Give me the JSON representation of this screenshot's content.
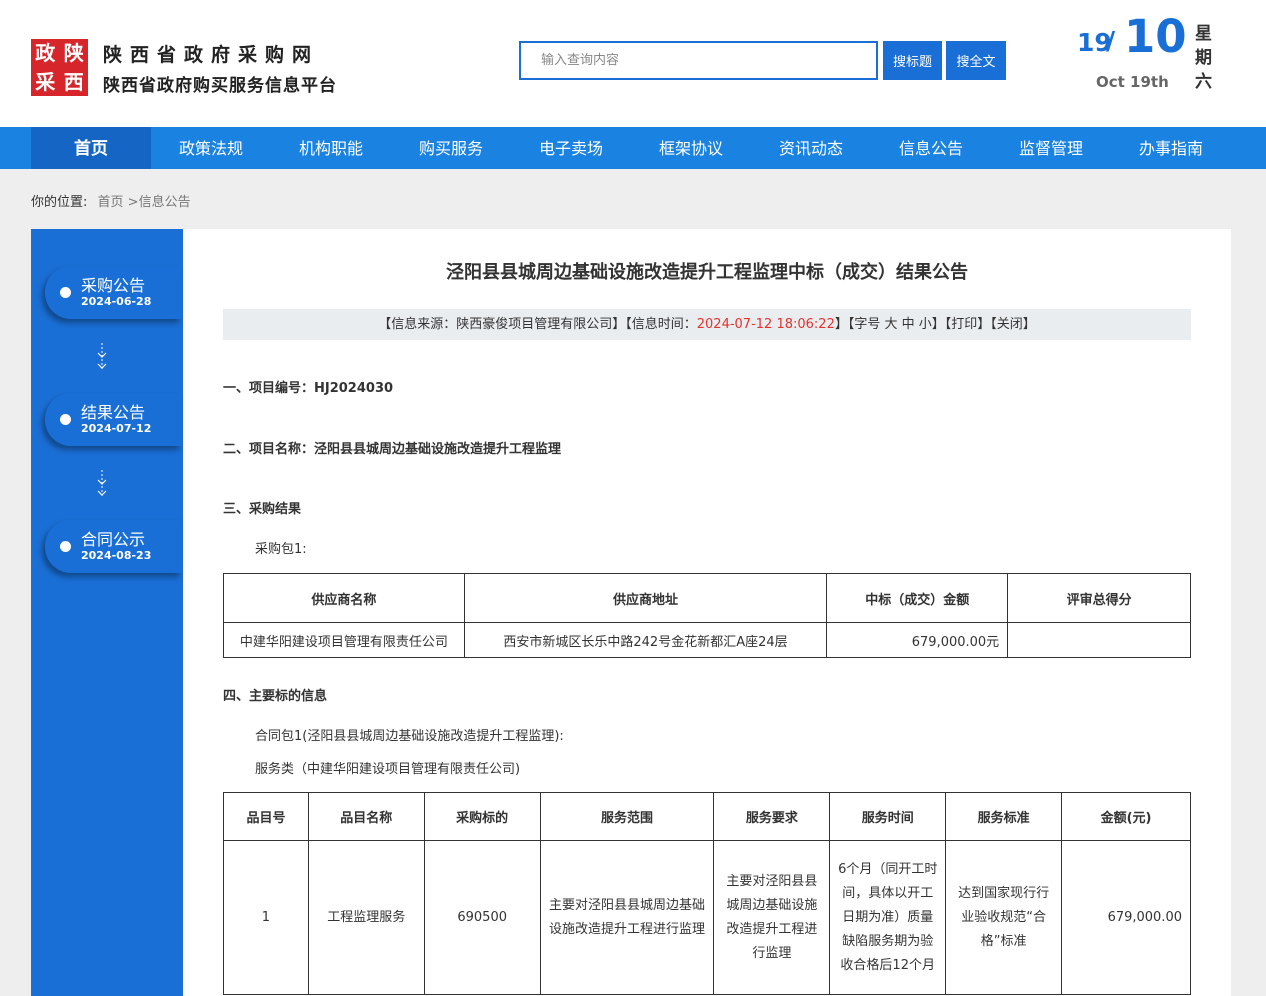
{
  "header": {
    "logo_chars": [
      "政",
      "陕",
      "采",
      "西"
    ],
    "site_title": "陕西省政府采购网",
    "site_subtitle": "陕西省政府购买服务信息平台",
    "search_placeholder": "输入查询内容",
    "btn_search_title": "搜标题",
    "btn_search_full": "搜全文",
    "date_day": "19",
    "date_slash": "/",
    "date_month": "10",
    "date_en": "Oct 19th",
    "date_week": "星期六"
  },
  "nav": {
    "items": [
      "首页",
      "政策法规",
      "机构职能",
      "购买服务",
      "电子卖场",
      "框架协议",
      "资讯动态",
      "信息公告",
      "监督管理",
      "办事指南"
    ]
  },
  "breadcrumb": {
    "prefix": "你的位置:",
    "home": "首页",
    "separator": " >",
    "current": "信息公告"
  },
  "sidebar": {
    "steps": [
      {
        "name": "采购公告",
        "date": "2024-06-28"
      },
      {
        "name": "结果公告",
        "date": "2024-07-12"
      },
      {
        "name": "合同公示",
        "date": "2024-08-23"
      }
    ]
  },
  "doc": {
    "title": "泾阳县县城周边基础设施改造提升工程监理中标（成交）结果公告",
    "info_source_prefix": "【信息来源：陕西豪俊项目管理有限公司】【信息时间：",
    "info_time": "2024-07-12 18:06:22",
    "info_suffix": "】【字号 大 中 小】【打印】【关闭】",
    "sec1": "一、项目编号：HJ2024030",
    "sec2": "二、项目名称：泾阳县县城周边基础设施改造提升工程监理",
    "sec3": "三、采购结果",
    "pkg": "采购包1:",
    "sec4": "四、主要标的信息",
    "contract_pkg": "合同包1(泾阳县县城周边基础设施改造提升工程监理):",
    "service_type": "服务类（中建华阳建设项目管理有限责任公司)"
  },
  "table1": {
    "headers": [
      "供应商名称",
      "供应商地址",
      "中标（成交）金额",
      "评审总得分"
    ],
    "row": [
      "中建华阳建设项目管理有限责任公司",
      "西安市新城区长乐中路242号金花新都汇A座24层",
      "679,000.00元",
      ""
    ]
  },
  "table2": {
    "headers": [
      "品目号",
      "品目名称",
      "采购标的",
      "服务范围",
      "服务要求",
      "服务时间",
      "服务标准",
      "金额(元)"
    ],
    "row": [
      "1",
      "工程监理服务",
      "690500",
      "主要对泾阳县县城周边基础设施改造提升工程进行监理",
      "主要对泾阳县县城周边基础设施改造提升工程进行监理",
      "6个月（同开工时间，具体以开工日期为准）质量缺陷服务期为验收合格后12个月",
      "达到国家现行行业验收规范“合格”标准",
      "679,000.00"
    ]
  }
}
